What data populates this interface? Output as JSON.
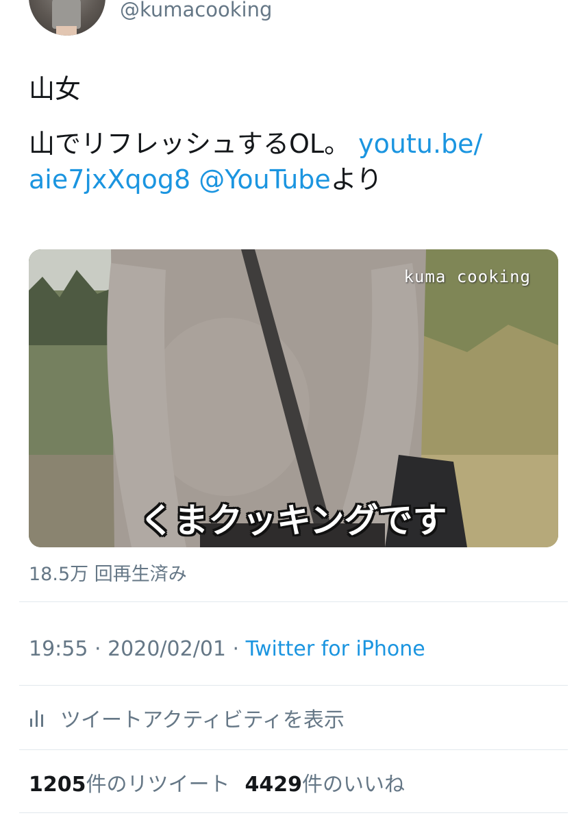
{
  "header": {
    "handle": "@kumacooking"
  },
  "tweet": {
    "line1": "山女",
    "line2_text": "山でリフレッシュするOL。 ",
    "link_part1": "youtu.be/",
    "link_part2": "aie7jxXqog8",
    "mention": "@YouTube",
    "suffix": "より"
  },
  "media": {
    "watermark": "kuma cooking",
    "subtitle": "くまクッキングです",
    "views": "18.5万 回再生済み"
  },
  "meta": {
    "time": "19:55",
    "sep1": " · ",
    "date": "2020/02/01",
    "sep2": " · ",
    "source": "Twitter for iPhone"
  },
  "activity": {
    "icon": "bar-chart-icon",
    "label": "ツイートアクティビティを表示"
  },
  "stats": {
    "retweet_count": "1205",
    "retweet_label": "件のリツイート",
    "like_count": "4429",
    "like_label": "件のいいね"
  },
  "colors": {
    "link": "#1b95e0",
    "secondary": "#657786",
    "divider": "#e1e8ed"
  }
}
